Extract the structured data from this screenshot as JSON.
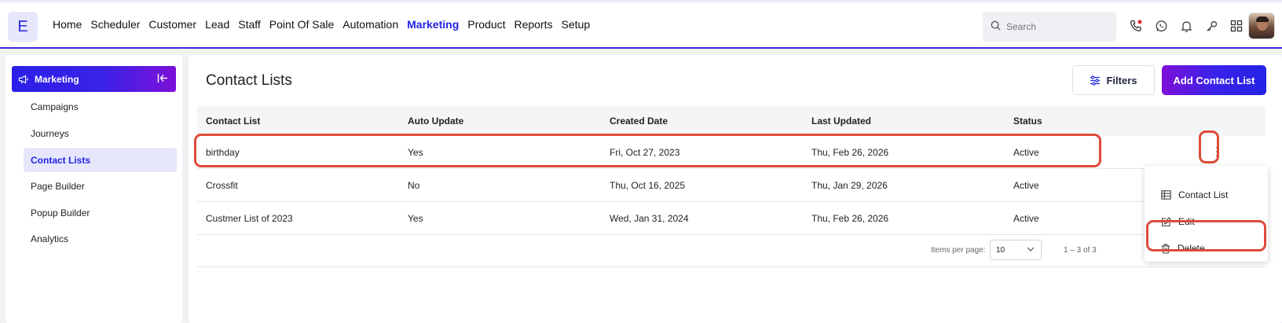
{
  "app": {
    "logo_letter": "E",
    "accent": "#2323e6",
    "highlight": "#de4b3a"
  },
  "nav": {
    "items": [
      {
        "label": "Home"
      },
      {
        "label": "Scheduler"
      },
      {
        "label": "Customer"
      },
      {
        "label": "Lead"
      },
      {
        "label": "Staff"
      },
      {
        "label": "Point Of Sale"
      },
      {
        "label": "Automation"
      },
      {
        "label": "Marketing",
        "active": true
      },
      {
        "label": "Product"
      },
      {
        "label": "Reports"
      },
      {
        "label": "Setup"
      }
    ]
  },
  "search": {
    "placeholder": "Search",
    "icon": "search-icon"
  },
  "top_icons": [
    "phone-icon",
    "whatsapp-icon",
    "bell-icon",
    "key-icon",
    "grid-icon"
  ],
  "sidebar": {
    "header": "Marketing",
    "items": [
      {
        "label": "Campaigns"
      },
      {
        "label": "Journeys"
      },
      {
        "label": "Contact Lists",
        "active": true
      },
      {
        "label": "Page Builder"
      },
      {
        "label": "Popup Builder"
      },
      {
        "label": "Analytics"
      }
    ]
  },
  "page": {
    "title": "Contact Lists",
    "filters_label": "Filters",
    "add_label": "Add Contact List"
  },
  "table": {
    "headers": [
      "Contact List",
      "Auto Update",
      "Created Date",
      "Last Updated",
      "Status"
    ],
    "rows": [
      [
        "birthday",
        "Yes",
        "Fri, Oct 27, 2023",
        "Thu, Feb 26, 2026",
        "Active"
      ],
      [
        "Crossfit",
        "No",
        "Thu, Oct 16, 2025",
        "Thu, Jan 29, 2026",
        "Active"
      ],
      [
        "Custmer List of 2023",
        "Yes",
        "Wed, Jan 31, 2024",
        "Thu, Feb 26, 2026",
        "Active"
      ]
    ]
  },
  "pagination": {
    "items_per_page_label": "Items per page:",
    "items_per_page_value": "10",
    "range": "1 – 3 of 3"
  },
  "row_menu": {
    "items": [
      {
        "label": "Contact List",
        "icon": "table-icon"
      },
      {
        "label": "Edit",
        "icon": "edit-icon"
      },
      {
        "label": "Delete",
        "icon": "trash-icon"
      }
    ]
  }
}
